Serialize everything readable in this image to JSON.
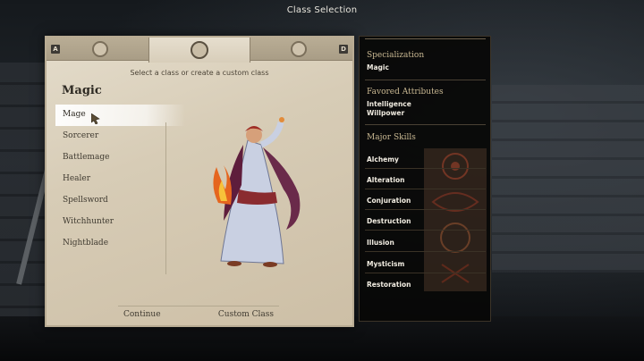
{
  "window": {
    "title": "Class Selection"
  },
  "tabs": {
    "left_key": "A",
    "right_key": "D"
  },
  "main": {
    "subtitle": "Select a class or create a custom class",
    "heading": "Magic",
    "classes": [
      "Mage",
      "Sorcerer",
      "Battlemage",
      "Healer",
      "Spellsword",
      "Witchhunter",
      "Nightblade"
    ],
    "selected_class": "Mage",
    "buttons": {
      "continue": "Continue",
      "custom": "Custom Class"
    }
  },
  "info": {
    "specialization_title": "Specialization",
    "specialization_value": "Magic",
    "attributes_title": "Favored Attributes",
    "attributes": [
      "Intelligence",
      "Willpower"
    ],
    "skills_title": "Major Skills",
    "skills": [
      "Alchemy",
      "Alteration",
      "Conjuration",
      "Destruction",
      "Illusion",
      "Mysticism",
      "Restoration"
    ]
  },
  "colors": {
    "parchment": "#d7ccb6",
    "panel": "#080706",
    "accent_title": "#c9b892"
  }
}
